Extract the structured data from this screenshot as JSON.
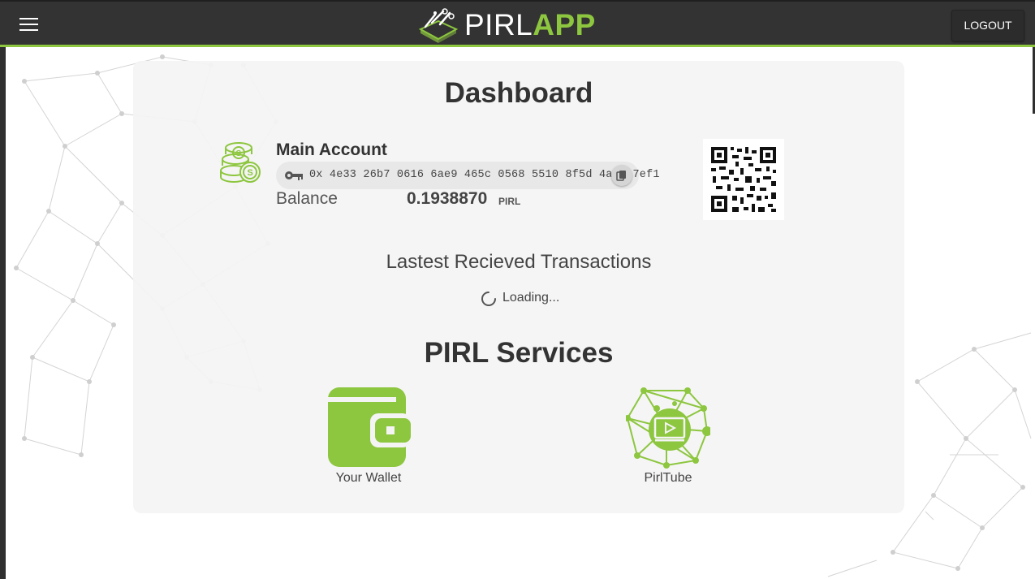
{
  "header": {
    "brand_primary": "PIRL",
    "brand_secondary": "APP",
    "logout_label": "LOGOUT",
    "accent_color": "#8dc63f",
    "bar_color": "#333333"
  },
  "dashboard": {
    "title": "Dashboard",
    "account": {
      "name": "Main Account",
      "address": "0x 4e33 26b7 0616 6ae9 465c 0568 5510 8f5d 4a4d 7ef1",
      "balance_label": "Balance",
      "balance_value": "0.1938870",
      "balance_unit": "PIRL"
    },
    "transactions": {
      "title": "Lastest Recieved Transactions",
      "loading_text": "Loading..."
    }
  },
  "services": {
    "title": "PIRL Services",
    "items": [
      {
        "label": "Your Wallet",
        "icon": "wallet-icon"
      },
      {
        "label": "PirlTube",
        "icon": "pirltube-icon"
      }
    ]
  },
  "icons": [
    "menu-icon",
    "pirl-logo-icon",
    "coins-icon",
    "key-icon",
    "copy-icon",
    "qr-code",
    "spinner-icon",
    "wallet-icon",
    "pirltube-icon"
  ]
}
